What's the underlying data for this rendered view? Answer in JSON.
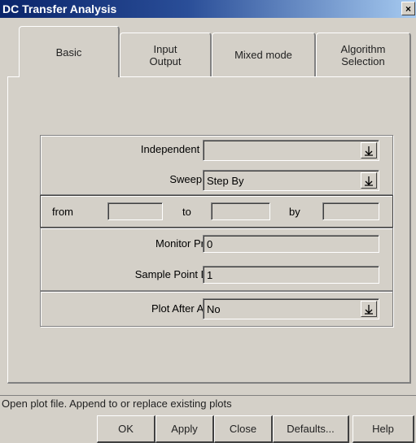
{
  "window": {
    "title": "DC Transfer Analysis",
    "close_glyph": "×"
  },
  "tabs": [
    {
      "label": "Basic",
      "active": true
    },
    {
      "label": "Input\nOutput",
      "active": false
    },
    {
      "label": "Mixed mode",
      "active": false
    },
    {
      "label": "Algorithm\nSelection",
      "active": false
    }
  ],
  "form": {
    "independent_source": {
      "label": "Independent Source",
      "value": ""
    },
    "sweep_range": {
      "label": "Sweep Range",
      "value": "Step By"
    },
    "range": {
      "from_label": "from",
      "from_value": "",
      "to_label": "to",
      "to_value": "",
      "by_label": "by",
      "by_value": ""
    },
    "monitor_progress": {
      "label": "Monitor Progress",
      "value": "0"
    },
    "sample_point_density": {
      "label": "Sample Point Density",
      "value": "1"
    },
    "plot_after_analysis": {
      "label": "Plot After Analysis",
      "value": "No"
    }
  },
  "status_text": "Open plot file. Append to or replace existing plots",
  "buttons": {
    "ok": "OK",
    "apply": "Apply",
    "close": "Close",
    "defaults": "Defaults...",
    "help": "Help"
  },
  "icons": {
    "dropdown": "dropdown-arrow-icon"
  }
}
